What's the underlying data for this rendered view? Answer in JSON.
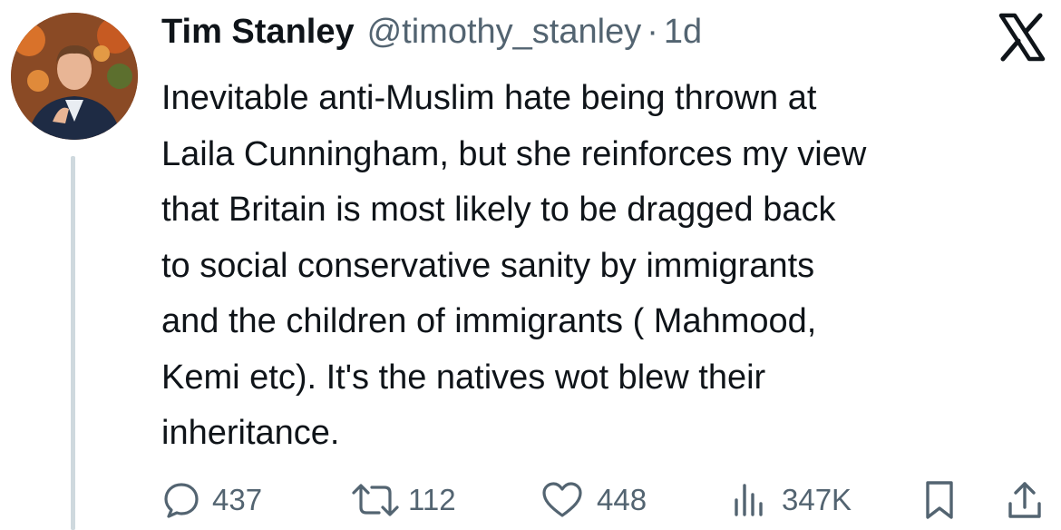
{
  "tweet": {
    "author_name": "Tim Stanley",
    "handle": "@timothy_stanley",
    "separator": "·",
    "time": "1d",
    "lines": [
      "Inevitable anti-Muslim hate being thrown at",
      "Laila Cunningham, but she reinforces my view",
      "that Britain is most likely to be dragged back",
      "to social conservative sanity by immigrants",
      "and the children of immigrants ( Mahmood,",
      "Kemi etc). It's the natives wot blew their",
      "inheritance."
    ]
  },
  "actions": {
    "replies": "437",
    "reposts": "112",
    "likes": "448",
    "views": "347K"
  },
  "icons": {
    "platform_logo": "x-logo-icon",
    "reply": "speech-bubble-icon",
    "repost": "repost-arrows-icon",
    "like": "heart-icon",
    "views": "bar-chart-icon",
    "bookmark": "bookmark-icon",
    "share": "share-upload-icon"
  },
  "colors": {
    "text": "#0f1419",
    "secondary": "#536471",
    "thread_line": "#cfd9de"
  }
}
